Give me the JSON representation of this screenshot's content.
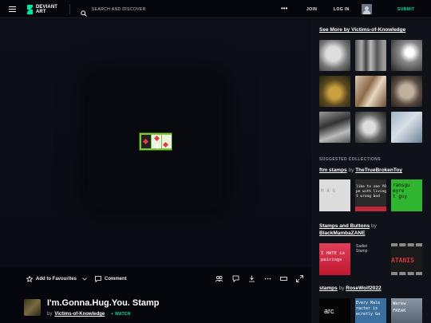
{
  "header": {
    "logo_line1": "DEVIANT",
    "logo_line2": "ART",
    "search_placeholder": "SEARCH AND DISCOVER",
    "more_label": "•••",
    "join_label": "JOIN",
    "login_label": "LOG IN",
    "submit_label": "SUBMIT",
    "accent_color": "#00e59b"
  },
  "actions": {
    "favourite_label": "Add to Favourites",
    "comment_label": "Comment"
  },
  "deviation": {
    "title": "I'm.Gonna.Hug.You. Stamp",
    "by_label": "by",
    "author": "Victims-of-Knowledge",
    "watch_label": "+ WATCH"
  },
  "sidebar": {
    "see_more_label": "See More by Victims-of-Knowledge",
    "suggested_label": "SUGGESTED COLLECTIONS",
    "collections": [
      {
        "name": "ftm stamps",
        "by": "by",
        "owner": "TheTrueBrokenToy",
        "thumb_texts": [
          "M A G",
          "like to see YO\npe with living\nt wrong bod",
          "ransgu\neyre\nt guy"
        ]
      },
      {
        "name": "Stamps and Buttons",
        "by": "by",
        "owner": "BlackMambaZANE",
        "thumb_texts": [
          "I HATE in\npairings",
          "Sadist\nStamp",
          "ATANIS"
        ]
      },
      {
        "name": "stamps",
        "by": "by",
        "owner": "RoseWolf2022",
        "thumb_texts": [
          "arc",
          "Every Male\nracter is\necretly Ga",
          "Werew\nFREAK"
        ]
      }
    ]
  }
}
